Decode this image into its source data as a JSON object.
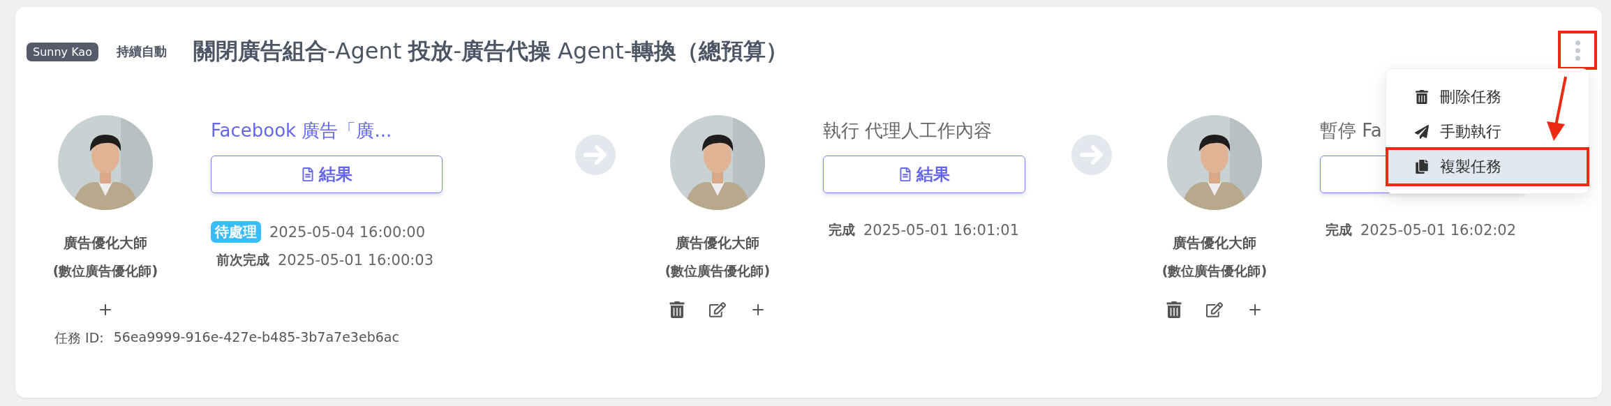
{
  "header": {
    "owner_badge": "Sunny Kao",
    "mode": "持續自動",
    "title": "**關閉廣告組合**-Agent **投放**-**廣告代操** Agent-**轉換（總預算）**",
    "more_button": {
      "highlighted": true
    }
  },
  "steps": [
    {
      "agent_name": "廣告優化大師",
      "agent_role": "(數位廣告優化師)",
      "title": "Facebook 廣告「廣...",
      "link": true,
      "button_label": "結果",
      "status_lines": [
        {
          "kind": "badge",
          "label": "待處理",
          "value": "2025-05-04 16:00:00"
        },
        {
          "kind": "label",
          "label": "前次完成",
          "value": "2025-05-01 16:00:03"
        }
      ],
      "actions": [
        {
          "kind": "add"
        }
      ]
    },
    {
      "agent_name": "廣告優化大師",
      "agent_role": "(數位廣告優化師)",
      "title": "執行 代理人工作內容",
      "link": false,
      "button_label": "結果",
      "status_lines": [
        {
          "kind": "label",
          "label": "完成",
          "value": "2025-05-01 16:01:01"
        }
      ],
      "actions": [
        {
          "kind": "delete"
        },
        {
          "kind": "edit"
        },
        {
          "kind": "add"
        }
      ]
    },
    {
      "agent_name": "廣告優化大師",
      "agent_role": "(數位廣告優化師)",
      "title": "暫停 Fa",
      "link": false,
      "status_lines": [
        {
          "kind": "label",
          "label": "完成",
          "value": "2025-05-01 16:02:02"
        }
      ],
      "actions": [
        {
          "kind": "delete"
        },
        {
          "kind": "edit"
        },
        {
          "kind": "add"
        }
      ]
    }
  ],
  "task_id": {
    "label": "任務 ID:",
    "value": "56ea9999-916e-427e-b485-3b7a7e3eb6ac"
  },
  "menu": {
    "items": [
      {
        "kind": "delete",
        "label": "刪除任務",
        "selected": false,
        "highlighted": false
      },
      {
        "kind": "run",
        "label": "手動執行",
        "selected": false,
        "highlighted": false
      },
      {
        "kind": "copy",
        "label": "複製任務",
        "selected": true,
        "highlighted": true
      }
    ]
  }
}
